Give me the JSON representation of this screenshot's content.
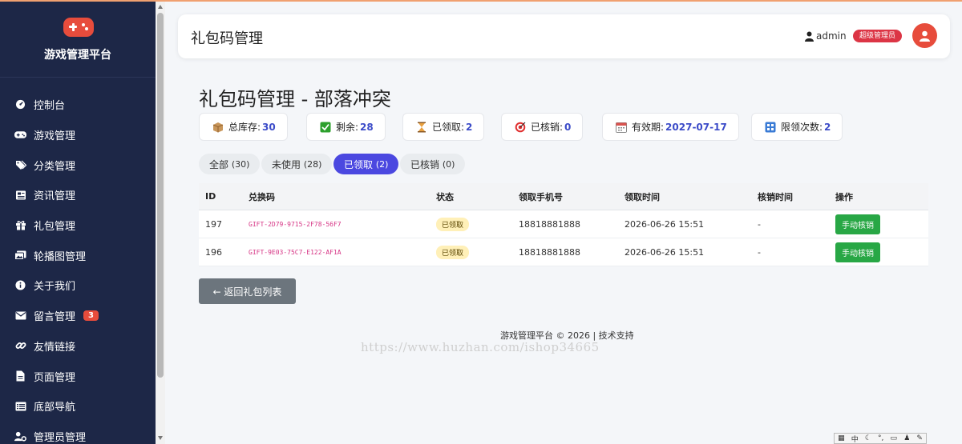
{
  "brand": {
    "title": "游戏管理平台"
  },
  "sidebar": {
    "items": [
      {
        "label": "控制台",
        "icon": "dashboard-icon"
      },
      {
        "label": "游戏管理",
        "icon": "gamepad-icon"
      },
      {
        "label": "分类管理",
        "icon": "tags-icon"
      },
      {
        "label": "资讯管理",
        "icon": "newspaper-icon"
      },
      {
        "label": "礼包管理",
        "icon": "gift-icon"
      },
      {
        "label": "轮播图管理",
        "icon": "images-icon"
      },
      {
        "label": "关于我们",
        "icon": "info-icon"
      },
      {
        "label": "留言管理",
        "icon": "envelope-icon",
        "badge": "3"
      },
      {
        "label": "友情链接",
        "icon": "link-icon"
      },
      {
        "label": "页面管理",
        "icon": "file-icon"
      },
      {
        "label": "底部导航",
        "icon": "list-icon"
      },
      {
        "label": "管理员管理",
        "icon": "user-gear-icon"
      }
    ]
  },
  "header": {
    "title": "礼包码管理",
    "username": "admin",
    "role": "超级管理员",
    "accent": "#e74c3c"
  },
  "page": {
    "title": "礼包码管理 - 部落冲突"
  },
  "stats": {
    "total": {
      "label": "总库存:",
      "value": "30"
    },
    "remaining": {
      "label": "剩余:",
      "value": "28"
    },
    "claimed": {
      "label": "已领取:",
      "value": "2"
    },
    "redeemed": {
      "label": "已核销:",
      "value": "0"
    },
    "expiry": {
      "label": "有效期:",
      "value": "2027-07-17"
    },
    "limit": {
      "label": "限领次数:",
      "value": "2"
    }
  },
  "filters": [
    {
      "label": "全部",
      "count": "(30)"
    },
    {
      "label": "未使用",
      "count": "(28)"
    },
    {
      "label": "已领取",
      "count": "(2)",
      "active": true
    },
    {
      "label": "已核销",
      "count": "(0)"
    }
  ],
  "table": {
    "headers": [
      "ID",
      "兑换码",
      "状态",
      "领取手机号",
      "领取时间",
      "核销时间",
      "操作"
    ],
    "rows": [
      {
        "id": "197",
        "code": "GIFT-2D79-9715-2F78-56F7",
        "status": "已领取",
        "phone": "18818881888",
        "claimed_at": "2026-06-26 15:51",
        "redeemed_at": "-",
        "action": "手动核销"
      },
      {
        "id": "196",
        "code": "GIFT-9E03-75C7-E122-AF1A",
        "status": "已领取",
        "phone": "18818881888",
        "claimed_at": "2026-06-26 15:51",
        "redeemed_at": "-",
        "action": "手动核销"
      }
    ]
  },
  "back_button": "← 返回礼包列表",
  "footer": {
    "text": "游戏管理平台 © 2026 | 技术支持"
  },
  "watermark": "https://www.huzhan.com/ishop34665",
  "ime_bar": {
    "label": "中"
  }
}
